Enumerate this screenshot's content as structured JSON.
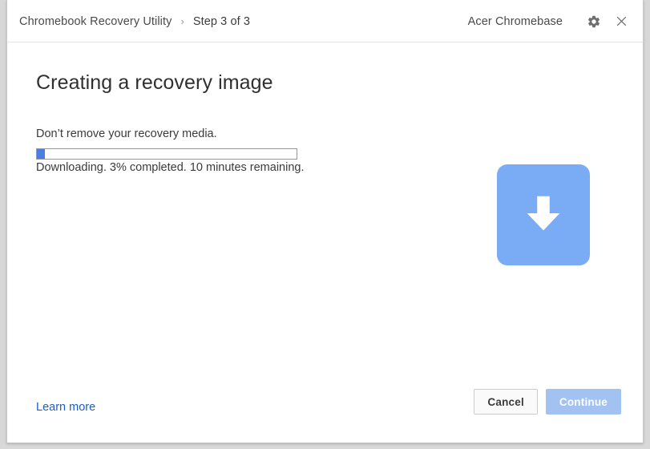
{
  "window": {
    "titlebar": {
      "app_name": "Chromebook Recovery Utility",
      "separator": "›",
      "step_label": "Step 3 of 3",
      "device_name": "Acer Chromebase",
      "settings_icon": "gear-icon",
      "close_icon": "close-icon"
    }
  },
  "main": {
    "title": "Creating a recovery image",
    "warning": "Don’t remove your recovery media.",
    "progress": {
      "percent": 3,
      "status": "Downloading. 3% completed. 10 minutes remaining.",
      "fill_color": "#4a7ee0",
      "track_border_color": "#989898"
    },
    "graphic": {
      "icon": "download-arrow-icon",
      "background_color": "#7aabf5",
      "arrow_color": "#ffffff"
    }
  },
  "footer": {
    "learn_more_label": "Learn more",
    "learn_more_color": "#1a5fd0",
    "cancel_label": "Cancel",
    "continue_label": "Continue",
    "continue_disabled_color": "#a2c2f2"
  }
}
